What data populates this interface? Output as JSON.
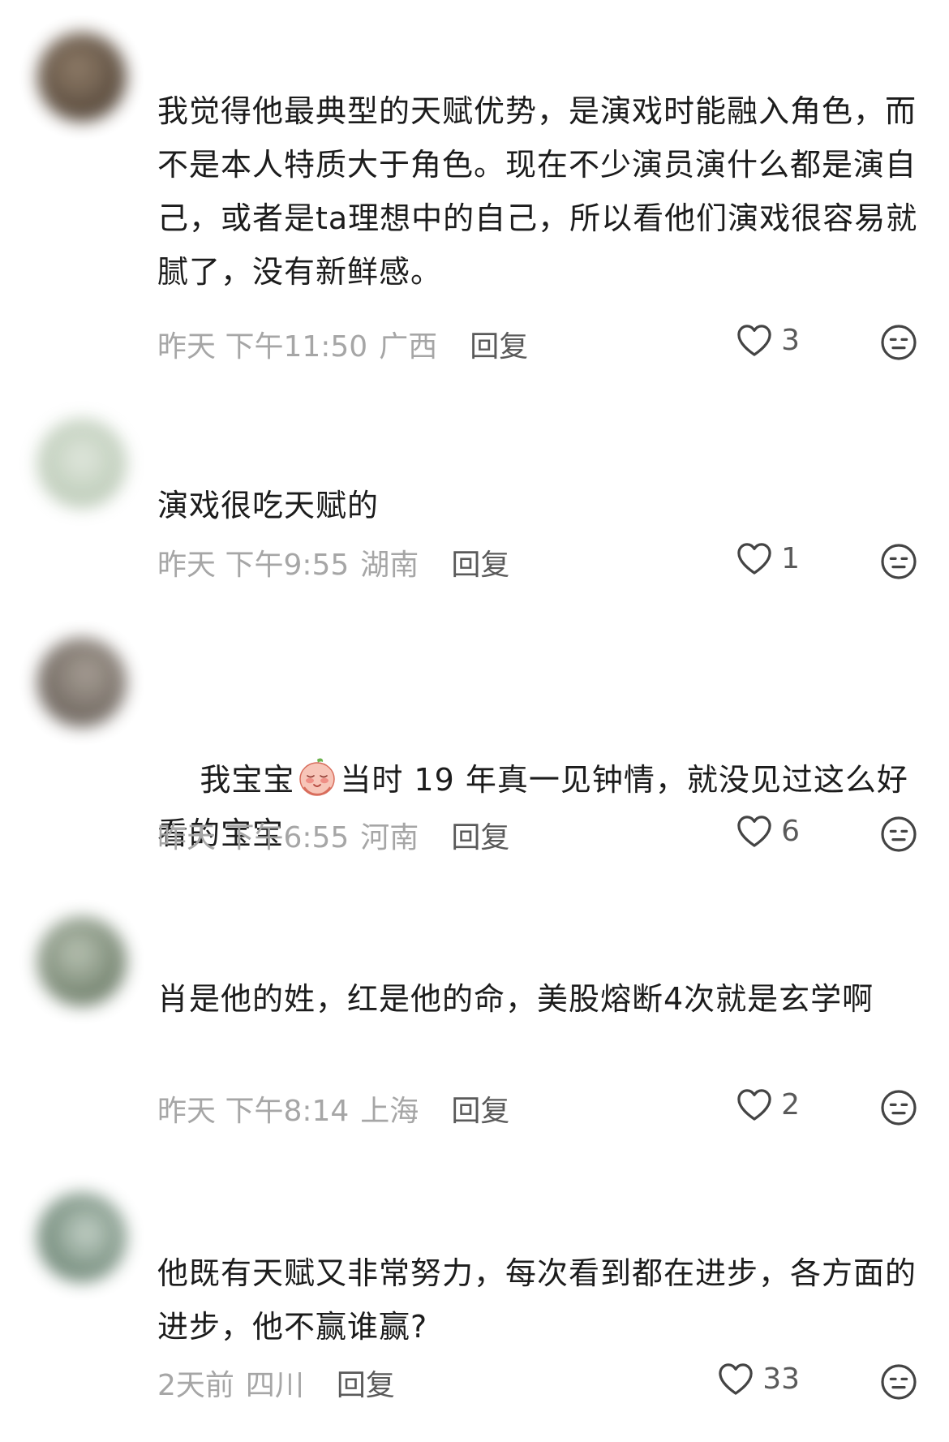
{
  "comments": [
    {
      "text": "我觉得他最典型的天赋优势，是演戏时能融入角色，而不是本人特质大于角色。现在不少演员演什么都是演自己，或者是ta理想中的自己，所以看他们演戏很容易就腻了，没有新鲜感。",
      "time": "昨天 下午11:50",
      "location": "广西",
      "reply_label": "回复",
      "likes": "3",
      "avatar_color": "#5b4a3a"
    },
    {
      "text": "演戏很吃天赋的",
      "time": "昨天 下午9:55",
      "location": "湖南",
      "reply_label": "回复",
      "likes": "1",
      "avatar_color": "#c9d6c4"
    },
    {
      "text_before_emoji": "我宝宝",
      "text_after_emoji": "当时 19 年真一见钟情，就没见过这么好看的宝宝",
      "inline_emoji": "blush-face-emoji",
      "time": "昨天 下午6:55",
      "location": "河南",
      "reply_label": "回复",
      "likes": "6",
      "avatar_color": "#6d655c"
    },
    {
      "text": "肖是他的姓，红是他的命，美股熔断4次就是玄学啊",
      "time": "昨天 下午8:14",
      "location": "上海",
      "reply_label": "回复",
      "likes": "2",
      "avatar_color": "#7b8a75"
    },
    {
      "text": "他既有天赋又非常努力，每次看到都在进步，各方面的进步，他不赢谁赢?",
      "time": "2天前",
      "location": "四川",
      "reply_label": "回复",
      "likes": "33",
      "avatar_color": "#6f8876"
    }
  ],
  "icons": {
    "like": "heart-icon",
    "dislike": "neutral-face-icon"
  },
  "colors": {
    "text": "#1c1c1c",
    "meta": "#a6a6a6",
    "action": "#5a5a5a"
  }
}
